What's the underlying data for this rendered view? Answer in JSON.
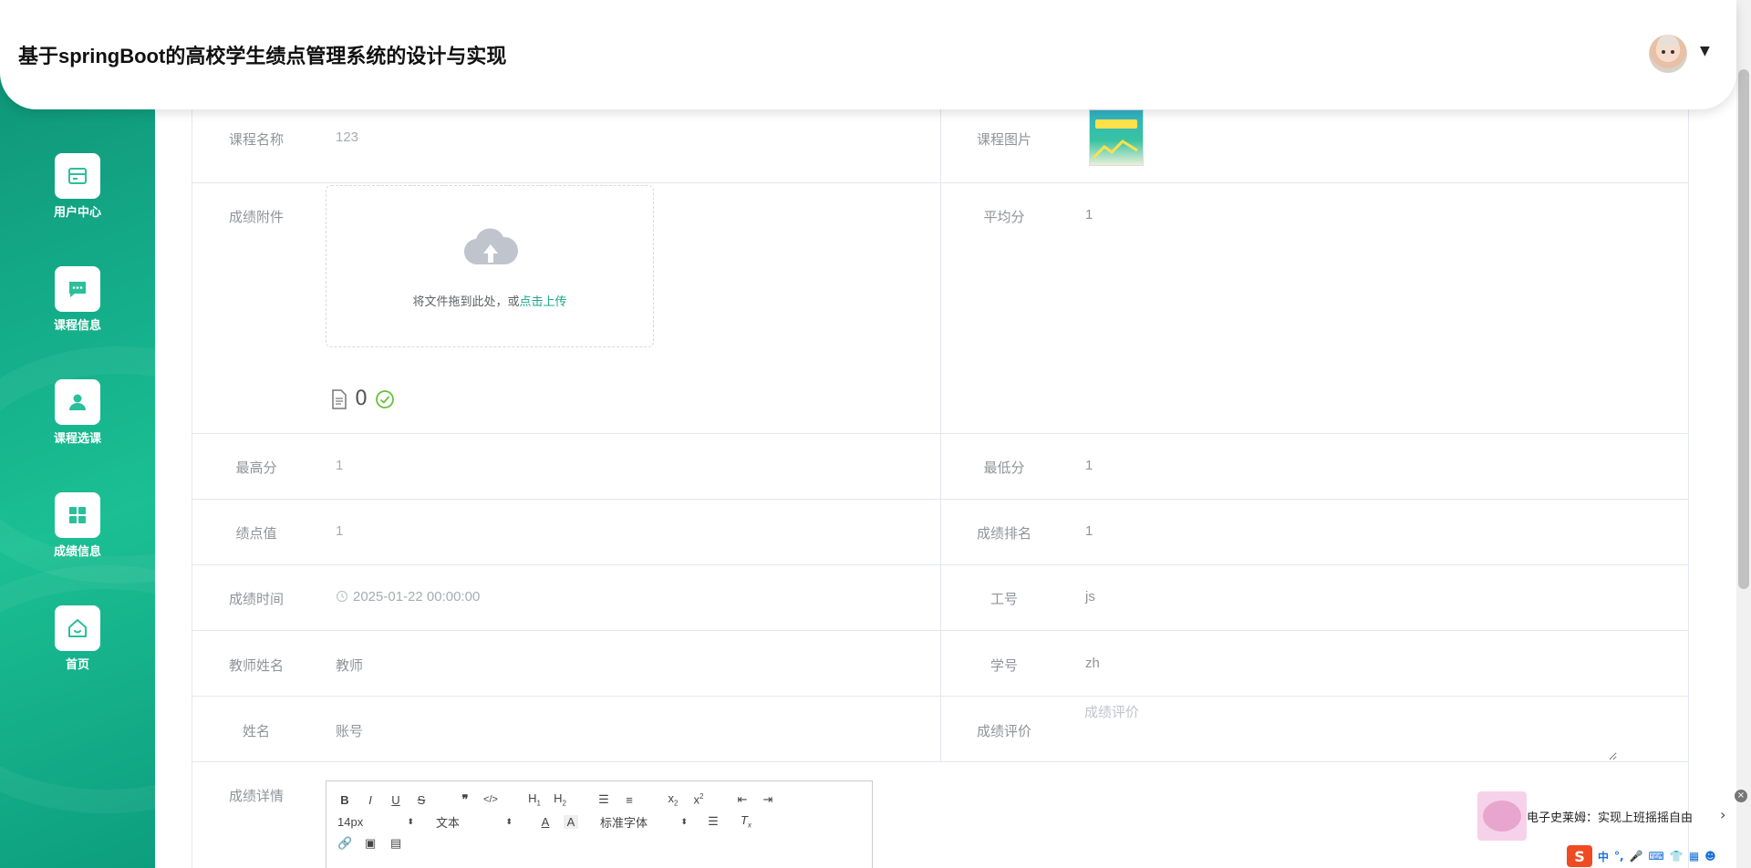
{
  "header": {
    "title": "基于springBoot的高校学生绩点管理系统的设计与实现"
  },
  "sidebar": {
    "items": [
      {
        "label": "用户中心",
        "icon": "user-center-icon"
      },
      {
        "label": "课程信息",
        "icon": "chat-icon"
      },
      {
        "label": "课程选课",
        "icon": "person-icon"
      },
      {
        "label": "成绩信息",
        "icon": "grid-icon"
      },
      {
        "label": "首页",
        "icon": "home-icon"
      }
    ]
  },
  "form": {
    "course_name": {
      "label": "课程名称",
      "value": "123"
    },
    "course_image": {
      "label": "课程图片"
    },
    "attachment": {
      "label": "成绩附件",
      "upload_text": "将文件拖到此处，或",
      "upload_link": "点击上传",
      "file_count": "0"
    },
    "average": {
      "label": "平均分",
      "value": "1"
    },
    "max_score": {
      "label": "最高分",
      "value": "1"
    },
    "min_score": {
      "label": "最低分",
      "value": "1"
    },
    "gpa": {
      "label": "绩点值",
      "value": "1"
    },
    "rank": {
      "label": "成绩排名",
      "value": "1"
    },
    "score_time": {
      "label": "成绩时间",
      "value": "2025-01-22 00:00:00"
    },
    "job_no": {
      "label": "工号",
      "value": "js"
    },
    "teacher_name": {
      "label": "教师姓名",
      "value": "教师"
    },
    "student_no": {
      "label": "学号",
      "value": "zh"
    },
    "name": {
      "label": "姓名",
      "value": "账号"
    },
    "evaluation": {
      "label": "成绩评价",
      "placeholder": "成绩评价"
    },
    "detail": {
      "label": "成绩详情"
    }
  },
  "editor": {
    "font_size": "14px",
    "block_type": "文本",
    "font_family": "标准字体"
  },
  "music_widget": {
    "text": "电子史莱姆：实现上班摇摇自由"
  },
  "ime": {
    "label": "中"
  },
  "colors": {
    "sidebar": "#15b08b",
    "accent": "#18a88b",
    "label": "#909399"
  }
}
